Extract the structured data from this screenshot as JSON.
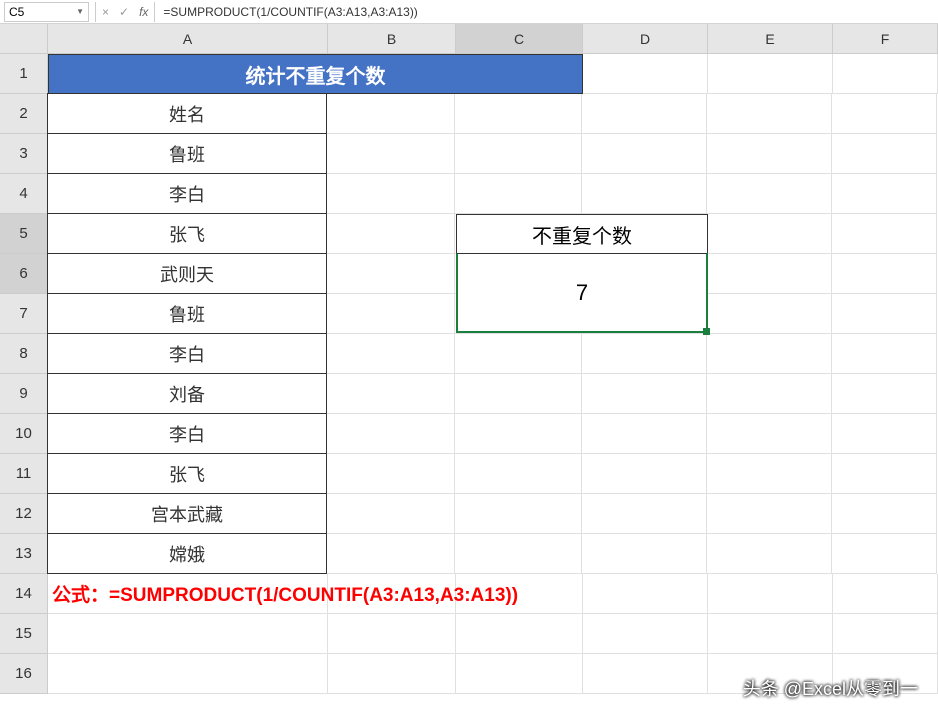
{
  "formula_bar": {
    "cell_ref": "C5",
    "formula": "=SUMPRODUCT(1/COUNTIF(A3:A13,A3:A13))",
    "cancel": "×",
    "confirm": "✓",
    "fx": "fx"
  },
  "columns": [
    "A",
    "B",
    "C",
    "D",
    "E",
    "F"
  ],
  "rows": [
    "1",
    "2",
    "3",
    "4",
    "5",
    "6",
    "7",
    "8",
    "9",
    "10",
    "11",
    "12",
    "13",
    "14",
    "15",
    "16"
  ],
  "title": "统计不重复个数",
  "name_header": "姓名",
  "data": [
    "鲁班",
    "李白",
    "张飞",
    "武则天",
    "鲁班",
    "李白",
    "刘备",
    "李白",
    "张飞",
    "宫本武藏",
    "嫦娥"
  ],
  "result": {
    "label": "不重复个数",
    "value": "7"
  },
  "formula_display": "公式：=SUMPRODUCT(1/COUNTIF(A3:A13,A3:A13))",
  "watermark": "头条 @Excel从零到一",
  "chart_data": {
    "type": "table",
    "title": "统计不重复个数",
    "columns": [
      "姓名"
    ],
    "rows": [
      [
        "鲁班"
      ],
      [
        "李白"
      ],
      [
        "张飞"
      ],
      [
        "武则天"
      ],
      [
        "鲁班"
      ],
      [
        "李白"
      ],
      [
        "刘备"
      ],
      [
        "李白"
      ],
      [
        "张飞"
      ],
      [
        "宫本武藏"
      ],
      [
        "嫦娥"
      ]
    ],
    "result_label": "不重复个数",
    "result_value": 7,
    "formula": "=SUMPRODUCT(1/COUNTIF(A3:A13,A3:A13))"
  }
}
